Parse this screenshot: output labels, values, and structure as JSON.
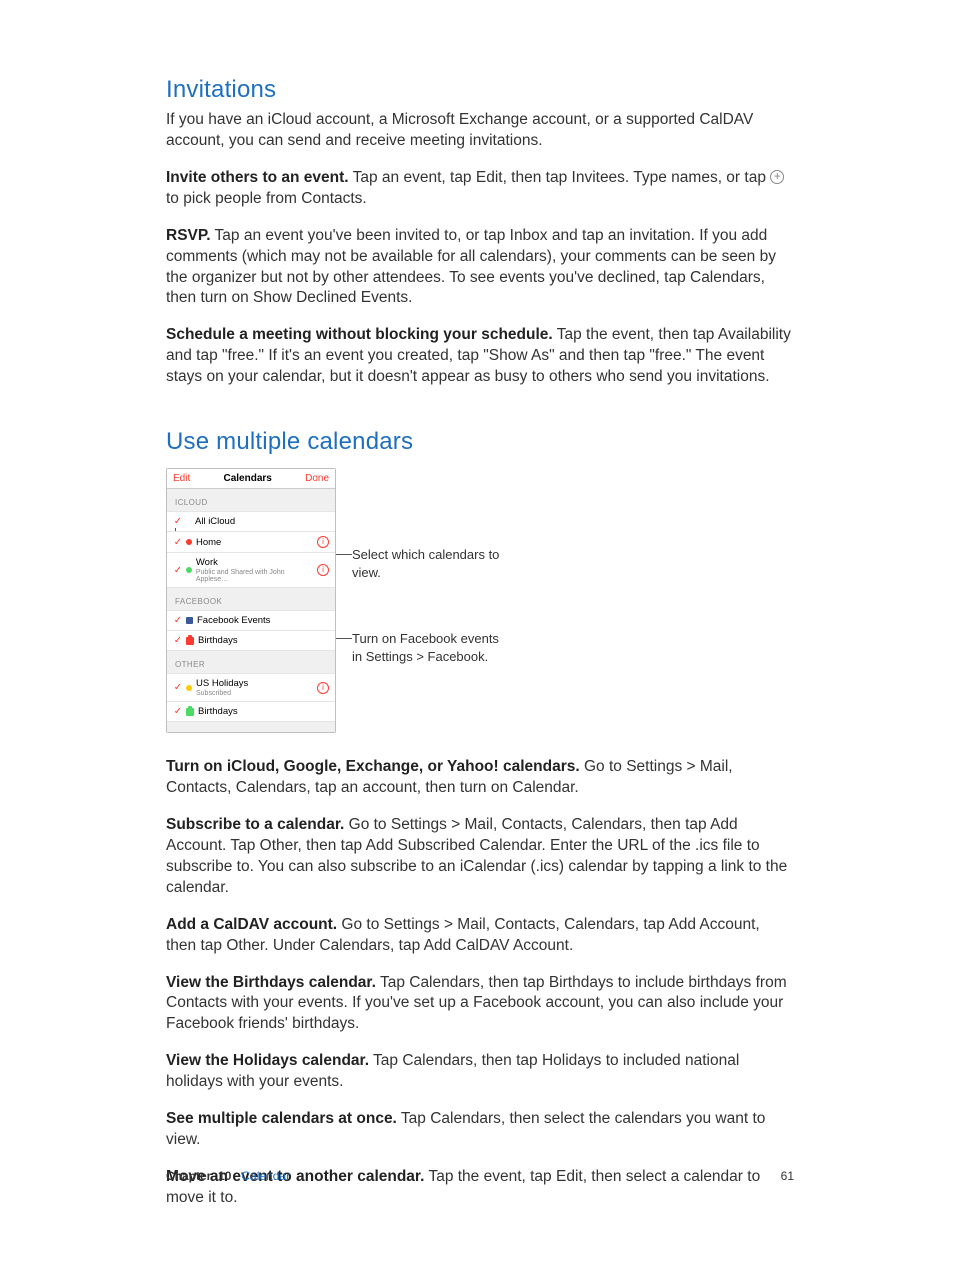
{
  "section1": {
    "title": "Invitations",
    "p1": "If you have an iCloud account, a Microsoft Exchange account, or a supported CalDAV account, you can send and receive meeting invitations.",
    "p2_strong": "Invite others to an event.",
    "p2_rest_a": " Tap an event, tap Edit, then tap Invitees. Type names, or tap ",
    "p2_rest_b": " to pick people from Contacts.",
    "p3_strong": "RSVP.",
    "p3_rest": " Tap an event you've been invited to, or tap Inbox and tap an invitation. If you add comments (which may not be available for all calendars), your comments can be seen by the organizer but not by other attendees. To see events you've declined, tap Calendars, then turn on Show Declined Events.",
    "p4_strong": "Schedule a meeting without blocking your schedule.",
    "p4_rest": " Tap the event, then tap Availability and tap \"free.\" If it's an event you created, tap \"Show As\" and then tap \"free.\" The event stays on your calendar, but it doesn't appear as busy to others who send you invitations."
  },
  "section2": {
    "title": "Use multiple calendars",
    "phone": {
      "edit": "Edit",
      "title": "Calendars",
      "done": "Done",
      "grp_icloud": "ICLOUD",
      "all_icloud": "All iCloud",
      "home": "Home",
      "work": "Work",
      "work_sub": "Public and Shared with John Applese…",
      "grp_fb": "FACEBOOK",
      "fb_events": "Facebook Events",
      "birthdays": "Birthdays",
      "grp_other": "OTHER",
      "us_holidays": "US Holidays",
      "subscribed": "Subscribed"
    },
    "callouts": {
      "c1": "Select which calendars to view.",
      "c2": "Turn on Facebook events in Settings > Facebook."
    },
    "p1_strong": "Turn on iCloud, Google, Exchange, or Yahoo! calendars.",
    "p1_rest": " Go to Settings > Mail, Contacts, Calendars, tap an account, then turn on Calendar.",
    "p2_strong": "Subscribe to a calendar.",
    "p2_rest": " Go to Settings > Mail, Contacts, Calendars, then tap Add Account. Tap Other, then tap Add Subscribed Calendar. Enter the URL of the .ics file to subscribe to. You can also subscribe to an iCalendar (.ics) calendar by tapping a link to the calendar.",
    "p3_strong": "Add a CalDAV account.",
    "p3_rest": " Go to Settings > Mail, Contacts, Calendars, tap Add Account, then tap Other. Under Calendars, tap Add CalDAV Account.",
    "p4_strong": "View the Birthdays calendar.",
    "p4_rest": " Tap Calendars, then tap Birthdays to include birthdays from Contacts with your events. If you've set up a Facebook account, you can also include your Facebook friends' birthdays.",
    "p5_strong": "View the Holidays calendar.",
    "p5_rest": " Tap Calendars, then tap Holidays to included national holidays with your events.",
    "p6_strong": "See multiple calendars at once.",
    "p6_rest": " Tap Calendars, then select the calendars you want to view.",
    "p7_strong": "Move an event to another calendar.",
    "p7_rest": " Tap the event, tap Edit, then select a calendar to move it to."
  },
  "footer": {
    "chapter_label": "Chapter",
    "chapter_num": "10",
    "section": "Calendar",
    "page": "61"
  }
}
